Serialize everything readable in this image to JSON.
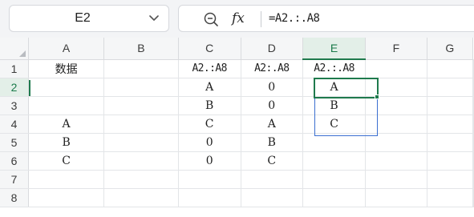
{
  "formula_bar": {
    "name_box": "E2",
    "name_box_chevron_icon": "chevron-down-icon",
    "zoom_icon": "zoom-icon",
    "fx_label": "fx",
    "formula": "=A2.:.A8"
  },
  "sheet": {
    "columns": [
      "A",
      "B",
      "C",
      "D",
      "E",
      "F",
      "G"
    ],
    "rows": [
      "1",
      "2",
      "3",
      "4",
      "5",
      "6",
      "7",
      "8"
    ],
    "active_cell": "E2",
    "active_column": "E",
    "active_row": "2",
    "cells": [
      [
        "数据",
        "",
        "A2.:A8",
        "A2:.A8",
        "A2.:.A8",
        "",
        ""
      ],
      [
        "",
        "",
        "A",
        "0",
        "A",
        "",
        ""
      ],
      [
        "",
        "",
        "B",
        "0",
        "B",
        "",
        ""
      ],
      [
        "A",
        "",
        "C",
        "A",
        "C",
        "",
        ""
      ],
      [
        "B",
        "",
        "0",
        "B",
        "",
        "",
        ""
      ],
      [
        "C",
        "",
        "0",
        "C",
        "",
        "",
        ""
      ],
      [
        "",
        "",
        "",
        "",
        "",
        "",
        ""
      ],
      [
        "",
        "",
        "",
        "",
        "",
        "",
        ""
      ]
    ]
  },
  "colors": {
    "accent_green": "#1f7a4d",
    "spill_border_blue": "#3a6fd0",
    "header_bg": "#f5f6f7"
  }
}
